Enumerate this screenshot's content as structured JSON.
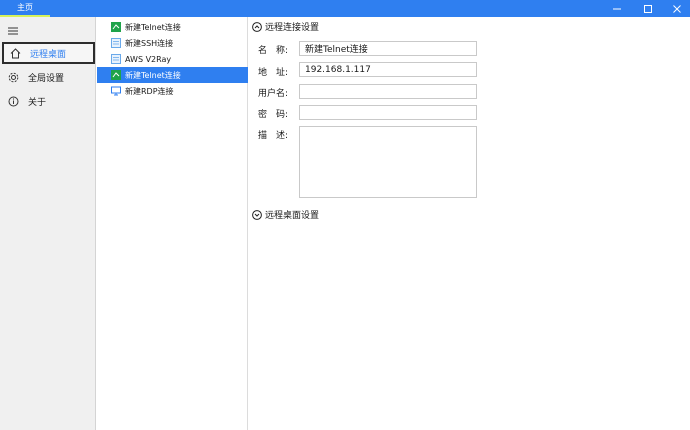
{
  "titlebar": {
    "tab_label": "主页",
    "accent_color": "#2f7ff0",
    "underline_color": "#d7f25a"
  },
  "nav": {
    "items": [
      {
        "label": "远程桌面",
        "icon": "home-icon",
        "active": true
      },
      {
        "label": "全局设置",
        "icon": "gear-icon",
        "active": false
      },
      {
        "label": "关于",
        "icon": "info-icon",
        "active": false
      }
    ]
  },
  "connections": [
    {
      "label": "新建Telnet连接",
      "icon": "telnet-icon",
      "selected": false
    },
    {
      "label": "新建SSH连接",
      "icon": "ssh-icon",
      "selected": false
    },
    {
      "label": "AWS V2Ray",
      "icon": "ssh-icon",
      "selected": false
    },
    {
      "label": "新建Telnet连接",
      "icon": "telnet-icon",
      "selected": true
    },
    {
      "label": "新建RDP连接",
      "icon": "rdp-icon",
      "selected": false
    }
  ],
  "detail": {
    "remote_section": "远程连接设置",
    "desktop_section": "远程桌面设置",
    "fields": {
      "name_label": "名　称:",
      "name_value": "新建Telnet连接",
      "address_label": "地　址:",
      "address_value": "192.168.1.117",
      "username_label": "用户名:",
      "username_value": "",
      "password_label": "密　码:",
      "password_value": "",
      "description_label": "描　述:",
      "description_value": ""
    }
  }
}
